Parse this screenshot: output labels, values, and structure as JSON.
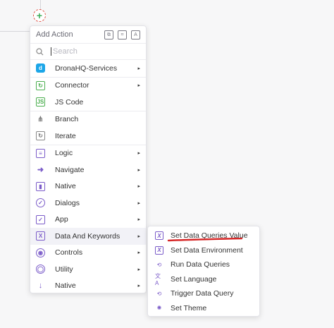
{
  "add_node": {
    "symbol": "+"
  },
  "menu": {
    "title": "Add Action",
    "header_icons": [
      "copy-icon",
      "scan-icon",
      "text-icon"
    ],
    "search": {
      "placeholder": "Search"
    },
    "sections": [
      [
        {
          "label": "DronaHQ-Services",
          "icon": "dronahq-logo-icon",
          "glyph": "d",
          "has_submenu": true
        }
      ],
      [
        {
          "label": "Connector",
          "icon": "connector-icon",
          "glyph": "↻",
          "has_submenu": true
        },
        {
          "label": "JS Code",
          "icon": "js-icon",
          "glyph": "JS",
          "has_submenu": false
        }
      ],
      [
        {
          "label": "Branch",
          "icon": "branch-icon",
          "glyph": "⋔",
          "has_submenu": false
        },
        {
          "label": "Iterate",
          "icon": "iterate-icon",
          "glyph": "↻",
          "has_submenu": false
        }
      ],
      [
        {
          "label": "Logic",
          "icon": "logic-icon",
          "glyph": "≡",
          "has_submenu": true
        },
        {
          "label": "Navigate",
          "icon": "navigate-icon",
          "glyph": "➜",
          "has_submenu": true
        },
        {
          "label": "Native",
          "icon": "native-icon",
          "glyph": "▮",
          "has_submenu": true
        },
        {
          "label": "Dialogs",
          "icon": "dialogs-icon",
          "glyph": "✓",
          "has_submenu": true
        },
        {
          "label": "App",
          "icon": "app-icon",
          "glyph": "✓",
          "has_submenu": true
        },
        {
          "label": "Data And Keywords",
          "icon": "data-keywords-icon",
          "glyph": "X",
          "has_submenu": true,
          "active": true
        },
        {
          "label": "Controls",
          "icon": "controls-icon",
          "glyph": "◉",
          "has_submenu": true
        },
        {
          "label": "Utility",
          "icon": "utility-icon",
          "glyph": "◯",
          "has_submenu": true
        },
        {
          "label": "Native",
          "icon": "download-icon",
          "glyph": "↓",
          "has_submenu": true
        }
      ]
    ]
  },
  "submenu": {
    "items": [
      {
        "label": "Set Data Queries Value",
        "icon": "variable-icon",
        "glyph": "X",
        "boxed": true
      },
      {
        "label": "Set Data Environment",
        "icon": "variable-icon",
        "glyph": "X",
        "boxed": true
      },
      {
        "label": "Run Data Queries",
        "icon": "run-query-icon",
        "glyph": "⟲",
        "boxed": false
      },
      {
        "label": "Set Language",
        "icon": "translate-icon",
        "glyph": "文A",
        "boxed": false
      },
      {
        "label": "Trigger Data Query",
        "icon": "trigger-query-icon",
        "glyph": "⟲",
        "boxed": false
      },
      {
        "label": "Set Theme",
        "icon": "theme-icon",
        "glyph": "✺",
        "boxed": false
      }
    ]
  },
  "colors": {
    "accent": "#7b5cc9",
    "dronahq": "#1ca6e8",
    "annotation": "#d62828"
  }
}
